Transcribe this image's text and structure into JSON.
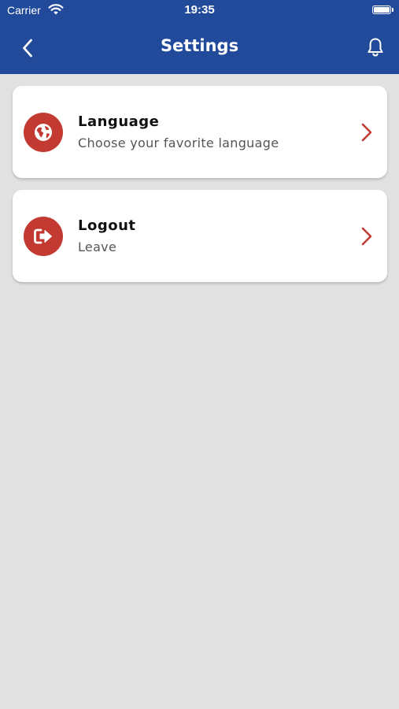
{
  "status_bar": {
    "carrier": "Carrier",
    "time": "19:35"
  },
  "nav": {
    "title": "Settings"
  },
  "items": [
    {
      "title": "Language",
      "subtitle": "Choose your favorite language",
      "icon": "globe-icon"
    },
    {
      "title": "Logout",
      "subtitle": "Leave",
      "icon": "logout-icon"
    }
  ],
  "colors": {
    "header": "#214a9a",
    "accent": "#c23a32",
    "background": "#e1e1e1",
    "card": "#ffffff"
  }
}
